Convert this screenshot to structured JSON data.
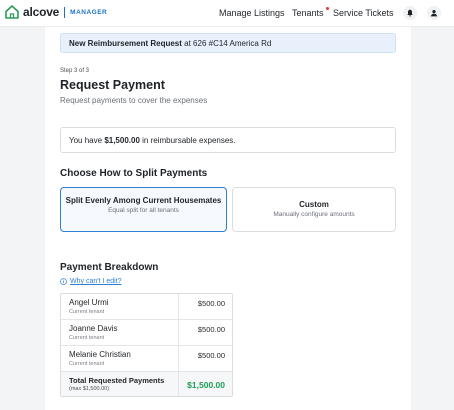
{
  "app": {
    "name": "alcove",
    "tag": "MANAGER"
  },
  "nav": {
    "manage_listings": "Manage Listings",
    "tenants": "Tenants",
    "service_tickets": "Service Tickets"
  },
  "banner": {
    "title": "New Reimbursement Request",
    "location": "at 626 #C14 America Rd"
  },
  "step": "Step 3 of 3",
  "page_title": "Request Payment",
  "page_subtitle": "Request payments to cover the expenses",
  "expenses": {
    "prefix": "You have",
    "amount": "$1,500.00",
    "suffix": "in reimbursable expenses."
  },
  "split": {
    "heading": "Choose How to Split Payments",
    "options": [
      {
        "title": "Split Evenly Among Current Housemates",
        "desc": "Equal split for all tenants",
        "selected": true
      },
      {
        "title": "Custom",
        "desc": "Manually configure amounts",
        "selected": false
      }
    ]
  },
  "breakdown": {
    "heading": "Payment Breakdown",
    "why_link": "Why can't I edit?",
    "rows": [
      {
        "name": "Angel Urmi",
        "role": "Current tenant",
        "amount": "$500.00"
      },
      {
        "name": "Joanne Davis",
        "role": "Current tenant",
        "amount": "$500.00"
      },
      {
        "name": "Melanie Christian",
        "role": "Current tenant",
        "amount": "$500.00"
      }
    ],
    "total_label": "Total Requested Payments",
    "total_max": "(max $1,500.00)",
    "total_value": "$1,500.00"
  },
  "colors": {
    "accent": "#2f80d1",
    "total_green": "#1e9e56",
    "notification_dot": "#e53935",
    "banner_bg": "#e7f0fb"
  },
  "icons": [
    "house-logo-icon",
    "bell-icon",
    "user-icon",
    "info-icon"
  ]
}
